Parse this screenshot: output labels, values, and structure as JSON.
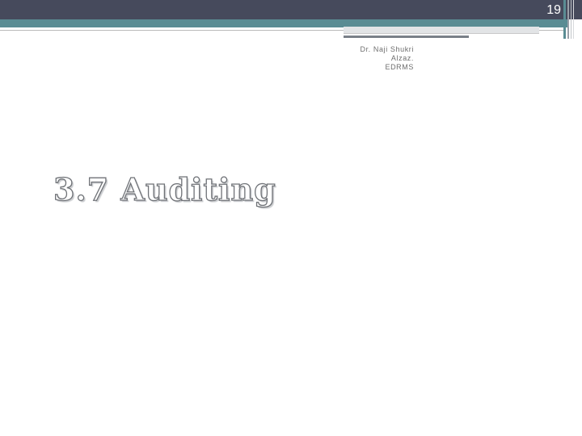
{
  "slide": {
    "page_number": "19",
    "author_line_1": "Dr. Naji Shukri Alzaz.",
    "author_line_2": "EDRMS",
    "title": "3.7 Auditing"
  },
  "colors": {
    "top_bar": "#464a5c",
    "accent_teal": "#5a8c93",
    "title_outline": "#6f7277",
    "author_text": "#6e6e6e"
  }
}
